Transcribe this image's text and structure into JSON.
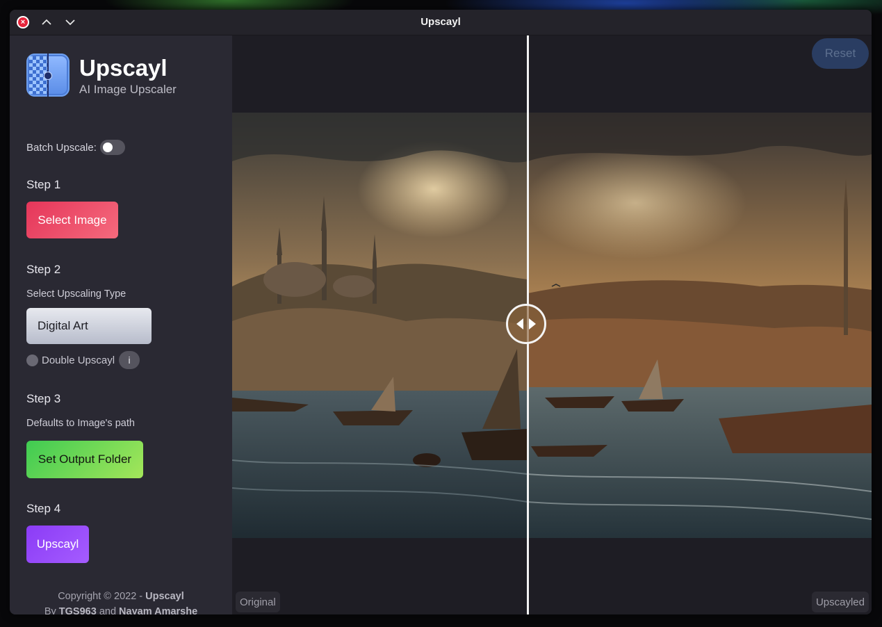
{
  "window": {
    "title": "Upscayl"
  },
  "sidebar": {
    "app_name": "Upscayl",
    "app_tagline": "AI Image Upscaler",
    "batch_label": "Batch Upscale:",
    "step1": {
      "title": "Step 1",
      "button": "Select Image"
    },
    "step2": {
      "title": "Step 2",
      "hint": "Select Upscaling Type",
      "type_value": "Digital Art",
      "double_label": "Double Upscayl",
      "info_icon": "i"
    },
    "step3": {
      "title": "Step 3",
      "hint": "Defaults to Image's path",
      "button": "Set Output Folder"
    },
    "step4": {
      "title": "Step 4",
      "button": "Upscayl"
    },
    "copyright": {
      "prefix": "Copyright © 2022 - ",
      "brand": "Upscayl",
      "by": "By ",
      "author1": "TGS963",
      "and": " and ",
      "author2": "Nayam Amarshe"
    }
  },
  "main": {
    "reset_label": "Reset",
    "label_original": "Original",
    "label_upscayled": "Upscayled"
  },
  "colors": {
    "select_image": "#e5365a",
    "set_output": "#3fcb52",
    "upscayl": "#8b3cf6",
    "reset_bg": "#2a3d62"
  },
  "icons": [
    "close-icon",
    "chevron-up-icon",
    "chevron-down-icon",
    "info-icon",
    "compare-arrows-icon"
  ]
}
